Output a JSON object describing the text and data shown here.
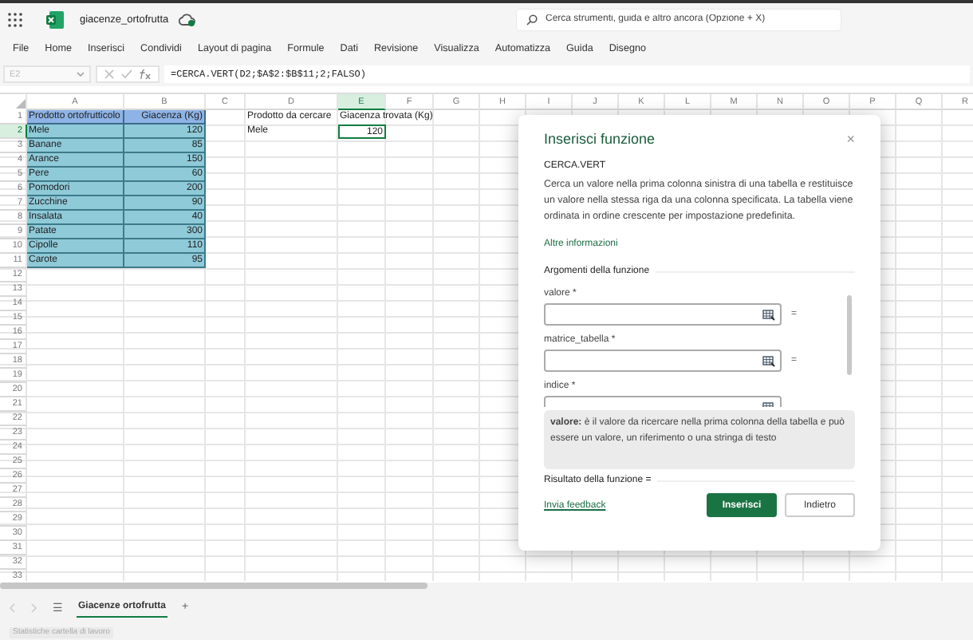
{
  "title_bar": {
    "file_name": "giacenze_ortofrutta",
    "search": {
      "placeholder": "Cerca strumenti, guida e altro ancora (Opzione + X)"
    }
  },
  "menu": [
    "File",
    "Home",
    "Inserisci",
    "Condividi",
    "Layout di pagina",
    "Formule",
    "Dati",
    "Revisione",
    "Visualizza",
    "Automatizza",
    "Guida",
    "Disegno"
  ],
  "formula_bar": {
    "name_box": "E2",
    "disabled": true,
    "formula": "=CERCA.VERT(D2;$A$2:$B$11;2;FALSO)"
  },
  "sheet": {
    "columns": [
      {
        "label": "A",
        "selected": false
      },
      {
        "label": "B",
        "selected": false
      },
      {
        "label": "C",
        "selected": false
      },
      {
        "label": "D",
        "selected": false
      },
      {
        "label": "E",
        "selected": true
      },
      {
        "label": "F",
        "selected": false
      },
      {
        "label": "G",
        "selected": false
      },
      {
        "label": "H",
        "selected": false
      },
      {
        "label": "I",
        "selected": false
      },
      {
        "label": "J",
        "selected": false
      },
      {
        "label": "K",
        "selected": false
      },
      {
        "label": "L",
        "selected": false
      },
      {
        "label": "M",
        "selected": false
      },
      {
        "label": "N",
        "selected": false
      },
      {
        "label": "O",
        "selected": false
      },
      {
        "label": "P",
        "selected": false
      },
      {
        "label": "Q",
        "selected": false
      },
      {
        "label": "R",
        "selected": false
      }
    ],
    "rows": [
      {
        "label": "1",
        "selected": false
      },
      {
        "label": "2",
        "selected": true
      },
      {
        "label": "3",
        "selected": false
      },
      {
        "label": "4",
        "selected": false
      },
      {
        "label": "5",
        "selected": false
      },
      {
        "label": "6",
        "selected": false
      },
      {
        "label": "7",
        "selected": false
      },
      {
        "label": "8",
        "selected": false
      },
      {
        "label": "9",
        "selected": false
      },
      {
        "label": "10",
        "selected": false
      },
      {
        "label": "11",
        "selected": false
      },
      {
        "label": "12",
        "selected": false
      },
      {
        "label": "13",
        "selected": false
      },
      {
        "label": "14",
        "selected": false
      },
      {
        "label": "15",
        "selected": false
      },
      {
        "label": "16",
        "selected": false
      },
      {
        "label": "17",
        "selected": false
      },
      {
        "label": "18",
        "selected": false
      },
      {
        "label": "19",
        "selected": false
      },
      {
        "label": "20",
        "selected": false
      },
      {
        "label": "21",
        "selected": false
      },
      {
        "label": "22",
        "selected": false
      },
      {
        "label": "23",
        "selected": false
      },
      {
        "label": "24",
        "selected": false
      },
      {
        "label": "25",
        "selected": false
      },
      {
        "label": "26",
        "selected": false
      },
      {
        "label": "27",
        "selected": false
      },
      {
        "label": "28",
        "selected": false
      },
      {
        "label": "29",
        "selected": false
      },
      {
        "label": "30",
        "selected": false
      },
      {
        "label": "31",
        "selected": false
      },
      {
        "label": "32",
        "selected": false
      },
      {
        "label": "33",
        "selected": false
      }
    ],
    "product_table": {
      "header": [
        "Prodotto ortofrutticolo",
        "Giacenza (Kg)"
      ],
      "rows": [
        [
          "Mele",
          "120"
        ],
        [
          "Banane",
          "85"
        ],
        [
          "Arance",
          "150"
        ],
        [
          "Pere",
          "60"
        ],
        [
          "Pomodori",
          "200"
        ],
        [
          "Zucchine",
          "90"
        ],
        [
          "Insalata",
          "40"
        ],
        [
          "Patate",
          "300"
        ],
        [
          "Cipolle",
          "110"
        ],
        [
          "Carote",
          "95"
        ]
      ]
    },
    "lookup": {
      "header": [
        "Prodotto da cercare",
        "Giacenza trovata (Kg)"
      ],
      "row": [
        "Mele",
        "120"
      ]
    }
  },
  "dialog": {
    "title": "Inserisci funzione",
    "close": "×",
    "function_name": "CERCA.VERT",
    "description": "Cerca un valore nella prima colonna sinistra di una tabella e restituisce un valore nella stessa riga da una colonna specificata. La tabella viene ordinata in ordine crescente per impostazione predefinita.",
    "more_link": "Altre informazioni",
    "arguments_heading": "Argomenti della funzione",
    "arguments": [
      {
        "label": "valore *",
        "sign": "="
      },
      {
        "label": "matrice_tabella *",
        "sign": "="
      },
      {
        "label": "indice *"
      }
    ],
    "help": "**valore:** è il valore da ricercare nella prima colonna della tabella e può essere un valore, un riferimento o una stringa di testo",
    "result": "Risultato della funzione =",
    "feedback_link": "Invia feedback",
    "buttons": [
      {
        "label": "Inserisci",
        "kind": "primary"
      },
      {
        "label": "Indietro",
        "kind": "secondary"
      }
    ]
  },
  "sheet_tabs": {
    "menu": "☰",
    "tabs": [
      {
        "label": "Giacenze ortofrutta",
        "selected": true
      }
    ],
    "add": "+"
  },
  "status_bar": "Statistiche cartella di lavoro"
}
